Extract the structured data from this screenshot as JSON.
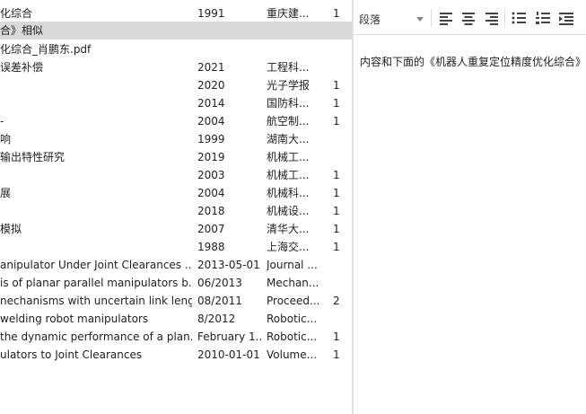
{
  "left_table": {
    "rows": [
      {
        "title": "化综合",
        "date": "1991",
        "source": "重庆建...",
        "count": "1",
        "selected": false
      },
      {
        "title": "合》相似",
        "date": "",
        "source": "",
        "count": "",
        "selected": true
      },
      {
        "title": "化综合_肖鹏东.pdf",
        "date": "",
        "source": "",
        "count": "",
        "selected": false
      },
      {
        "title": "误差补偿",
        "date": "2021",
        "source": "工程科...",
        "count": "",
        "selected": false
      },
      {
        "title": "",
        "date": "2020",
        "source": "光子学报",
        "count": "1",
        "selected": false
      },
      {
        "title": "",
        "date": "2014",
        "source": "国防科...",
        "count": "1",
        "selected": false
      },
      {
        "title": "-",
        "date": "2004",
        "source": "航空制...",
        "count": "1",
        "selected": false
      },
      {
        "title": "响",
        "date": "1999",
        "source": "湖南大...",
        "count": "",
        "selected": false
      },
      {
        "title": "输出特性研究",
        "date": "2019",
        "source": "机械工...",
        "count": "",
        "selected": false
      },
      {
        "title": "",
        "date": "2003",
        "source": "机械工...",
        "count": "1",
        "selected": false
      },
      {
        "title": "展",
        "date": "2004",
        "source": "机械科...",
        "count": "1",
        "selected": false
      },
      {
        "title": "",
        "date": "2018",
        "source": "机械设...",
        "count": "1",
        "selected": false
      },
      {
        "title": "模拟",
        "date": "2007",
        "source": "清华大...",
        "count": "1",
        "selected": false
      },
      {
        "title": "",
        "date": "1988",
        "source": "上海交...",
        "count": "1",
        "selected": false
      },
      {
        "title": "anipulator Under Joint Clearances ...",
        "date": "2013-05-01",
        "source": "Journal ...",
        "count": "",
        "selected": false
      },
      {
        "title": "is of planar parallel manipulators b...",
        "date": "06/2013",
        "source": "Mechan...",
        "count": "",
        "selected": false
      },
      {
        "title": "nechanisms with uncertain link leng...",
        "date": "08/2011",
        "source": "Proceed...",
        "count": "2",
        "selected": false
      },
      {
        "title": "welding robot manipulators",
        "date": "8/2012",
        "source": "Robotic...",
        "count": "",
        "selected": false
      },
      {
        "title": "the dynamic performance of a plan...",
        "date": "February 1...",
        "source": "Robotic...",
        "count": "1",
        "selected": false
      },
      {
        "title": "ulators to Joint Clearances",
        "date": "2010-01-01",
        "source": "Volume...",
        "count": "1",
        "selected": false
      }
    ]
  },
  "toolbar": {
    "paragraph_style": "段落",
    "icons": [
      "align-left-icon",
      "align-center-icon",
      "align-right-icon",
      "bullet-list-icon",
      "numbered-list-icon",
      "indent-icon"
    ]
  },
  "editor": {
    "text": "内容和下面的《机器人重复定位精度优化综合》"
  }
}
